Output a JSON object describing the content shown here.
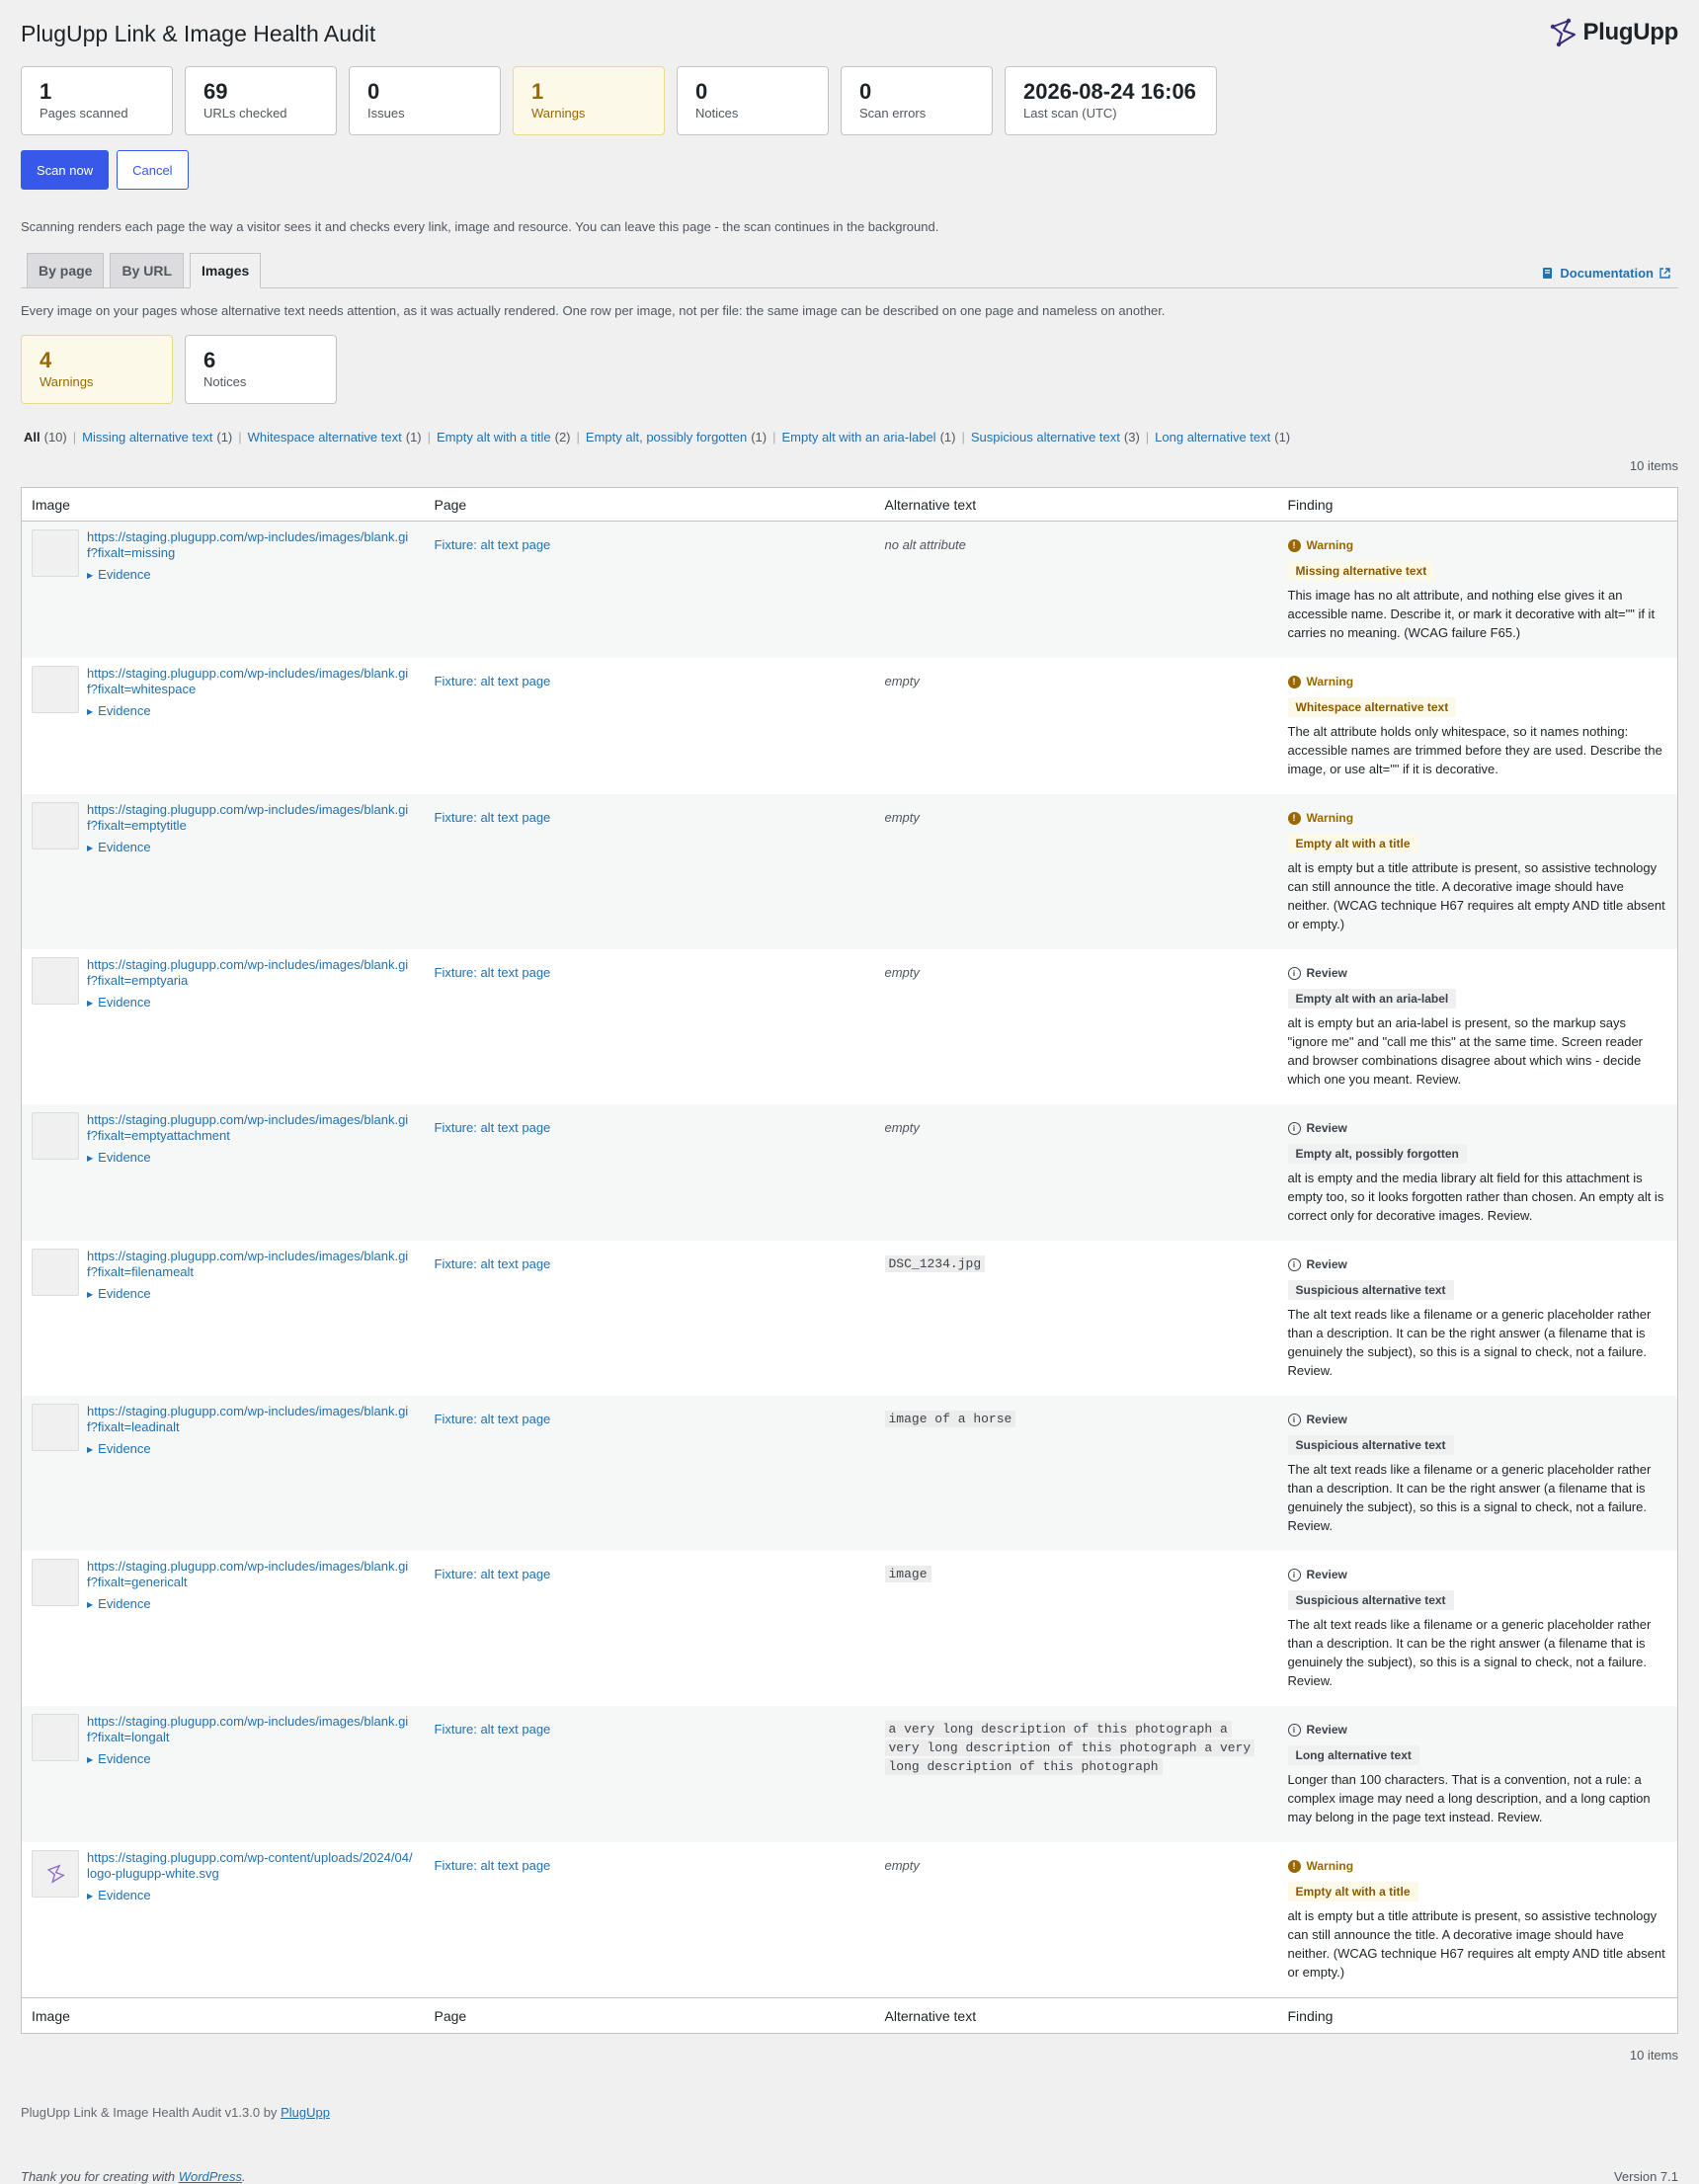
{
  "header": {
    "title": "PlugUpp Link & Image Health Audit",
    "logo_text": "PlugUpp"
  },
  "stats": [
    {
      "value": "1",
      "label": "Pages scanned"
    },
    {
      "value": "69",
      "label": "URLs checked"
    },
    {
      "value": "0",
      "label": "Issues"
    },
    {
      "value": "1",
      "label": "Warnings"
    },
    {
      "value": "0",
      "label": "Notices"
    },
    {
      "value": "0",
      "label": "Scan errors"
    },
    {
      "value": "2026-08-24 16:06",
      "label": "Last scan (UTC)"
    }
  ],
  "actions": {
    "scan_now": "Scan now",
    "cancel": "Cancel"
  },
  "scan_help": "Scanning renders each page the way a visitor sees it and checks every link, image and resource. You can leave this page - the scan continues in the background.",
  "tabs": [
    {
      "label": "By page"
    },
    {
      "label": "By URL"
    },
    {
      "label": "Images"
    }
  ],
  "documentation_label": "Documentation",
  "images_intro": "Every image on your pages whose alternative text needs attention, as it was actually rendered. One row per image, not per file: the same image can be described on one page and nameless on another.",
  "image_stats": [
    {
      "value": "4",
      "label": "Warnings"
    },
    {
      "value": "6",
      "label": "Notices"
    }
  ],
  "filters": [
    {
      "label": "All",
      "count": "(10)"
    },
    {
      "label": "Missing alternative text",
      "count": "(1)"
    },
    {
      "label": "Whitespace alternative text",
      "count": "(1)"
    },
    {
      "label": "Empty alt with a title",
      "count": "(2)"
    },
    {
      "label": "Empty alt, possibly forgotten",
      "count": "(1)"
    },
    {
      "label": "Empty alt with an aria-label",
      "count": "(1)"
    },
    {
      "label": "Suspicious alternative text",
      "count": "(3)"
    },
    {
      "label": "Long alternative text",
      "count": "(1)"
    }
  ],
  "items_count": "10 items",
  "columns": {
    "image": "Image",
    "page": "Page",
    "alt": "Alternative text",
    "finding": "Finding"
  },
  "rows": [
    {
      "url": "https://staging.plugupp.com/wp-includes/images/blank.gif?fixalt=missing",
      "evidence": "Evidence",
      "page": "Fixture: alt text page",
      "alt": "no alt attribute",
      "severity": "Warning",
      "badge": "Missing alternative text",
      "description": "This image has no alt attribute, and nothing else gives it an accessible name. Describe it, or mark it decorative with alt=\"\" if it carries no meaning. (WCAG failure F65.)"
    },
    {
      "url": "https://staging.plugupp.com/wp-includes/images/blank.gif?fixalt=whitespace",
      "evidence": "Evidence",
      "page": "Fixture: alt text page",
      "alt": "empty",
      "severity": "Warning",
      "badge": "Whitespace alternative text",
      "description": "The alt attribute holds only whitespace, so it names nothing: accessible names are trimmed before they are used. Describe the image, or use alt=\"\" if it is decorative."
    },
    {
      "url": "https://staging.plugupp.com/wp-includes/images/blank.gif?fixalt=emptytitle",
      "evidence": "Evidence",
      "page": "Fixture: alt text page",
      "alt": "empty",
      "severity": "Warning",
      "badge": "Empty alt with a title",
      "description": "alt is empty but a title attribute is present, so assistive technology can still announce the title. A decorative image should have neither. (WCAG technique H67 requires alt empty AND title absent or empty.)"
    },
    {
      "url": "https://staging.plugupp.com/wp-includes/images/blank.gif?fixalt=emptyaria",
      "evidence": "Evidence",
      "page": "Fixture: alt text page",
      "alt": "empty",
      "severity": "Review",
      "badge": "Empty alt with an aria-label",
      "description": "alt is empty but an aria-label is present, so the markup says \"ignore me\" and \"call me this\" at the same time. Screen reader and browser combinations disagree about which wins - decide which one you meant. Review."
    },
    {
      "url": "https://staging.plugupp.com/wp-includes/images/blank.gif?fixalt=emptyattachment",
      "evidence": "Evidence",
      "page": "Fixture: alt text page",
      "alt": "empty",
      "severity": "Review",
      "badge": "Empty alt, possibly forgotten",
      "description": "alt is empty and the media library alt field for this attachment is empty too, so it looks forgotten rather than chosen. An empty alt is correct only for decorative images. Review."
    },
    {
      "url": "https://staging.plugupp.com/wp-includes/images/blank.gif?fixalt=filenamealt",
      "evidence": "Evidence",
      "page": "Fixture: alt text page",
      "alt_code": "DSC_1234.jpg",
      "severity": "Review",
      "badge": "Suspicious alternative text",
      "description": "The alt text reads like a filename or a generic placeholder rather than a description. It can be the right answer (a filename that is genuinely the subject), so this is a signal to check, not a failure. Review."
    },
    {
      "url": "https://staging.plugupp.com/wp-includes/images/blank.gif?fixalt=leadinalt",
      "evidence": "Evidence",
      "page": "Fixture: alt text page",
      "alt_code": "image of a horse",
      "severity": "Review",
      "badge": "Suspicious alternative text",
      "description": "The alt text reads like a filename or a generic placeholder rather than a description. It can be the right answer (a filename that is genuinely the subject), so this is a signal to check, not a failure. Review."
    },
    {
      "url": "https://staging.plugupp.com/wp-includes/images/blank.gif?fixalt=genericalt",
      "evidence": "Evidence",
      "page": "Fixture: alt text page",
      "alt_code": "image",
      "severity": "Review",
      "badge": "Suspicious alternative text",
      "description": "The alt text reads like a filename or a generic placeholder rather than a description. It can be the right answer (a filename that is genuinely the subject), so this is a signal to check, not a failure. Review."
    },
    {
      "url": "https://staging.plugupp.com/wp-includes/images/blank.gif?fixalt=longalt",
      "evidence": "Evidence",
      "page": "Fixture: alt text page",
      "alt_code": "a very long description of this photograph a very long description of this photograph a very long description of this photograph",
      "severity": "Review",
      "badge": "Long alternative text",
      "description": "Longer than 100 characters. That is a convention, not a rule: a complex image may need a long description, and a long caption may belong in the page text instead. Review."
    },
    {
      "url": "https://staging.plugupp.com/wp-content/uploads/2024/04/logo-plugupp-white.svg",
      "evidence": "Evidence",
      "page": "Fixture: alt text page",
      "alt": "empty",
      "severity": "Warning",
      "badge": "Empty alt with a title",
      "description": "alt is empty but a title attribute is present, so assistive technology can still announce the title. A decorative image should have neither. (WCAG technique H67 requires alt empty AND title absent or empty.)",
      "thumb_logo": true
    }
  ],
  "footer": {
    "plugin_version": "PlugUpp Link & Image Health Audit v1.3.0 by",
    "plugin_link": "PlugUpp",
    "thanks_prefix": "Thank you for creating with",
    "thanks_link": "WordPress",
    "thanks_suffix": ".",
    "wp_version": "Version 7.1"
  },
  "colors": {
    "accent": "#3858e9",
    "link": "#2271b1",
    "warning": "#996800",
    "warning_bg": "#fcf9e8"
  }
}
